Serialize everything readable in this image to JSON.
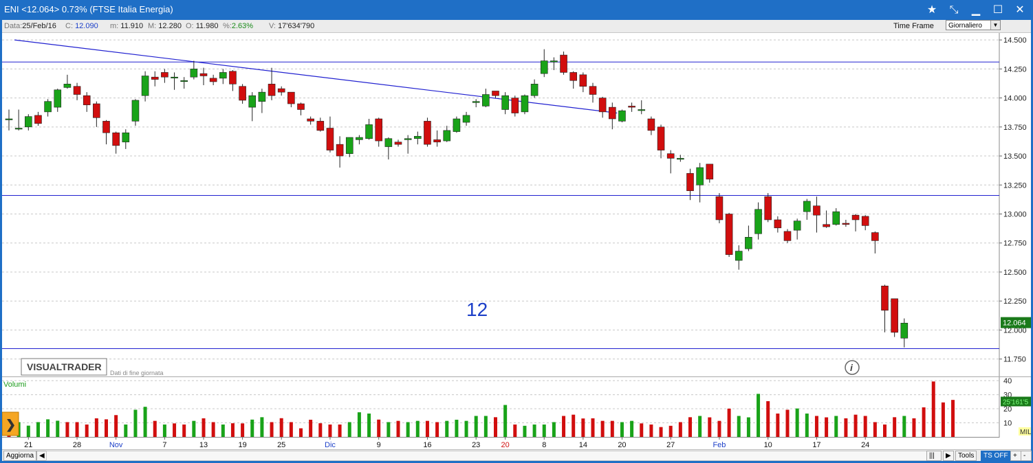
{
  "window": {
    "title": "ENI <12.064>  0.73%  (FTSE Italia Energia)"
  },
  "infobar": {
    "date_label": "Data:",
    "date_value": "25/Feb/16",
    "close_label": "C:",
    "close_value": "12.090",
    "min_label": "m:",
    "min_value": "11.910",
    "max_label": "M:",
    "max_value": "12.280",
    "open_label": "O:",
    "open_value": "11.980",
    "pct_label": "%:",
    "pct_value": "2.63%",
    "vol_label": "V:",
    "vol_value": "17'634'790",
    "timeframe_label": "Time Frame",
    "timeframe_value": "Giornaliero"
  },
  "colors": {
    "up": "#19a319",
    "down": "#d10e0e",
    "trendline": "#2020d0",
    "grid": "#c8c8c8",
    "frame": "#1f6fc6"
  },
  "chart_data": [
    {
      "type": "candlestick",
      "title": "",
      "ylim": [
        11.6,
        14.56
      ],
      "yticks": [
        "14.500",
        "14.250",
        "14.000",
        "13.750",
        "13.500",
        "13.250",
        "13.000",
        "12.750",
        "12.500",
        "12.250",
        "12.000",
        "11.750"
      ],
      "ytick_values": [
        14.5,
        14.25,
        14.0,
        13.75,
        13.5,
        13.25,
        13.0,
        12.75,
        12.5,
        12.25,
        12.0,
        11.75
      ],
      "grid": true,
      "x_ticks": [
        {
          "i": 2,
          "label": "21",
          "color": "#111"
        },
        {
          "i": 7,
          "label": "28",
          "color": "#111"
        },
        {
          "i": 11,
          "label": "Nov",
          "color": "#1c3fc8"
        },
        {
          "i": 16,
          "label": "7",
          "color": "#111"
        },
        {
          "i": 20,
          "label": "13",
          "color": "#111"
        },
        {
          "i": 24,
          "label": "19",
          "color": "#111"
        },
        {
          "i": 28,
          "label": "25",
          "color": "#111"
        },
        {
          "i": 33,
          "label": "Dic",
          "color": "#1c3fc8"
        },
        {
          "i": 38,
          "label": "9",
          "color": "#111"
        },
        {
          "i": 43,
          "label": "16",
          "color": "#111"
        },
        {
          "i": 48,
          "label": "23",
          "color": "#111"
        },
        {
          "i": 51,
          "label": "20",
          "color": "#d10e0e"
        },
        {
          "i": 55,
          "label": "8",
          "color": "#111"
        },
        {
          "i": 59,
          "label": "14",
          "color": "#111"
        },
        {
          "i": 63,
          "label": "20",
          "color": "#111"
        },
        {
          "i": 68,
          "label": "27",
          "color": "#111"
        },
        {
          "i": 73,
          "label": "Feb",
          "color": "#1c3fc8"
        },
        {
          "i": 78,
          "label": "10",
          "color": "#111"
        },
        {
          "i": 83,
          "label": "17",
          "color": "#111"
        },
        {
          "i": 88,
          "label": "24",
          "color": "#111"
        }
      ],
      "candles": [
        [
          13.82,
          13.82,
          13.9,
          13.72
        ],
        [
          13.74,
          13.74,
          13.9,
          13.72
        ],
        [
          13.75,
          13.84,
          13.86,
          13.72
        ],
        [
          13.85,
          13.78,
          13.88,
          13.76
        ],
        [
          13.88,
          13.97,
          13.99,
          13.84
        ],
        [
          13.92,
          14.07,
          14.08,
          13.88
        ],
        [
          14.09,
          14.12,
          14.2,
          14.08
        ],
        [
          14.1,
          14.03,
          14.13,
          13.98
        ],
        [
          14.02,
          13.94,
          14.05,
          13.88
        ],
        [
          13.95,
          13.83,
          13.97,
          13.75
        ],
        [
          13.8,
          13.7,
          13.81,
          13.6
        ],
        [
          13.7,
          13.59,
          13.71,
          13.52
        ],
        [
          13.62,
          13.7,
          13.73,
          13.56
        ],
        [
          13.8,
          13.98,
          13.99,
          13.76
        ],
        [
          14.02,
          14.19,
          14.23,
          13.97
        ],
        [
          14.18,
          14.16,
          14.23,
          14.1
        ],
        [
          14.22,
          14.18,
          14.25,
          14.13
        ],
        [
          14.18,
          14.18,
          14.22,
          14.07
        ],
        [
          14.15,
          14.15,
          14.18,
          14.08
        ],
        [
          14.18,
          14.25,
          14.32,
          14.16
        ],
        [
          14.21,
          14.19,
          14.26,
          14.11
        ],
        [
          14.17,
          14.14,
          14.2,
          14.11
        ],
        [
          14.17,
          14.22,
          14.25,
          14.12
        ],
        [
          14.23,
          14.12,
          14.24,
          14.06
        ],
        [
          14.1,
          13.98,
          14.12,
          13.95
        ],
        [
          13.92,
          14.02,
          14.05,
          13.8
        ],
        [
          13.97,
          14.05,
          14.08,
          13.87
        ],
        [
          14.12,
          14.02,
          14.26,
          13.98
        ],
        [
          14.08,
          14.05,
          14.1,
          14.02
        ],
        [
          14.05,
          13.95,
          14.05,
          13.92
        ],
        [
          13.95,
          13.9,
          13.96,
          13.85
        ],
        [
          13.82,
          13.8,
          13.84,
          13.77
        ],
        [
          13.8,
          13.72,
          13.83,
          13.71
        ],
        [
          13.74,
          13.55,
          13.84,
          13.53
        ],
        [
          13.6,
          13.5,
          13.67,
          13.4
        ],
        [
          13.52,
          13.66,
          13.66,
          13.49
        ],
        [
          13.64,
          13.66,
          13.68,
          13.6
        ],
        [
          13.65,
          13.77,
          13.82,
          13.64
        ],
        [
          13.82,
          13.63,
          13.83,
          13.58
        ],
        [
          13.58,
          13.65,
          13.66,
          13.47
        ],
        [
          13.62,
          13.6,
          13.64,
          13.58
        ],
        [
          13.64,
          13.65,
          13.68,
          13.52
        ],
        [
          13.65,
          13.67,
          13.71,
          13.6
        ],
        [
          13.8,
          13.6,
          13.83,
          13.58
        ],
        [
          13.64,
          13.62,
          13.72,
          13.58
        ],
        [
          13.63,
          13.72,
          13.76,
          13.62
        ],
        [
          13.71,
          13.82,
          13.84,
          13.7
        ],
        [
          13.79,
          13.85,
          13.88,
          13.76
        ],
        [
          13.96,
          13.97,
          13.99,
          13.92
        ],
        [
          13.93,
          14.03,
          14.08,
          13.92
        ],
        [
          14.06,
          14.02,
          14.06,
          14.0
        ],
        [
          13.9,
          14.02,
          14.05,
          13.86
        ],
        [
          14.0,
          13.87,
          14.02,
          13.84
        ],
        [
          13.88,
          14.02,
          14.03,
          13.86
        ],
        [
          14.02,
          14.12,
          14.16,
          14.0
        ],
        [
          14.21,
          14.32,
          14.42,
          14.18
        ],
        [
          14.31,
          14.32,
          14.35,
          14.24
        ],
        [
          14.37,
          14.22,
          14.4,
          14.2
        ],
        [
          14.22,
          14.15,
          14.23,
          14.08
        ],
        [
          14.2,
          14.1,
          14.22,
          14.05
        ],
        [
          14.1,
          14.03,
          14.13,
          13.96
        ],
        [
          14.0,
          13.88,
          14.01,
          13.83
        ],
        [
          13.92,
          13.82,
          13.96,
          13.73
        ],
        [
          13.8,
          13.89,
          13.9,
          13.79
        ],
        [
          13.93,
          13.92,
          13.96,
          13.88
        ],
        [
          13.9,
          13.9,
          13.98,
          13.86
        ],
        [
          13.82,
          13.72,
          13.84,
          13.68
        ],
        [
          13.75,
          13.55,
          13.77,
          13.48
        ],
        [
          13.52,
          13.48,
          13.55,
          13.35
        ],
        [
          13.48,
          13.48,
          13.51,
          13.45
        ],
        [
          13.35,
          13.2,
          13.39,
          13.12
        ],
        [
          13.25,
          13.4,
          13.44,
          13.1
        ],
        [
          13.43,
          13.3,
          13.43,
          13.27
        ],
        [
          13.15,
          12.95,
          13.18,
          12.92
        ],
        [
          13.0,
          12.65,
          13.01,
          12.63
        ],
        [
          12.6,
          12.68,
          12.73,
          12.52
        ],
        [
          12.7,
          12.8,
          12.9,
          12.68
        ],
        [
          12.83,
          13.04,
          13.1,
          12.78
        ],
        [
          13.15,
          12.95,
          13.18,
          12.93
        ],
        [
          12.95,
          12.88,
          12.98,
          12.84
        ],
        [
          12.85,
          12.77,
          12.87,
          12.75
        ],
        [
          12.86,
          12.94,
          12.96,
          12.78
        ],
        [
          13.02,
          13.11,
          13.13,
          12.95
        ],
        [
          13.07,
          12.99,
          13.15,
          12.84
        ],
        [
          12.91,
          12.89,
          13.03,
          12.88
        ],
        [
          12.91,
          13.02,
          13.05,
          12.9
        ],
        [
          12.92,
          12.91,
          12.95,
          12.89
        ],
        [
          12.99,
          12.95,
          13.0,
          12.85
        ],
        [
          12.98,
          12.9,
          12.99,
          12.86
        ],
        [
          12.84,
          12.77,
          12.85,
          12.66
        ],
        [
          12.38,
          12.17,
          12.39,
          11.98
        ],
        [
          12.27,
          11.98,
          12.27,
          11.94
        ],
        [
          11.93,
          12.06,
          12.1,
          11.85
        ]
      ],
      "trendline": {
        "x1": 0,
        "y1": 14.5,
        "x2": 62.5,
        "y2": 13.87
      },
      "hlines": [
        14.31,
        13.16,
        11.84
      ],
      "annotation": "12",
      "price_marker": "12.064",
      "logo_text": "VISUALTRADER",
      "logo_note": "Dati di fine giornata",
      "info_icon": "info-icon"
    },
    {
      "type": "bar",
      "title": "Volumi",
      "ylim": [
        0,
        42
      ],
      "yticks": [
        "40",
        "30",
        "20",
        "10"
      ],
      "ytick_values": [
        40,
        30,
        20,
        10
      ],
      "unit_label": "MIL",
      "last_value_label": "25'161'5",
      "values": [
        17,
        10.5,
        8,
        10.5,
        12.5,
        11.5,
        10.5,
        10.5,
        8.8,
        13.2,
        12.5,
        15.5,
        8.8,
        19.3,
        21.4,
        11.4,
        8.8,
        9.6,
        8.8,
        11.4,
        13.2,
        10.5,
        8.8,
        9.7,
        9.6,
        12.3,
        14.0,
        10.5,
        13.3,
        10.5,
        6.1,
        12.2,
        9.7,
        8.8,
        8.8,
        10.5,
        17.5,
        16.6,
        12.3,
        10.5,
        11.4,
        10.5,
        11.4,
        11.4,
        10.5,
        11.4,
        12.2,
        11.4,
        14.9,
        14.9,
        14.0,
        22.7,
        8.8,
        7.9,
        8.8,
        8.8,
        10.5,
        14.9,
        15.8,
        13.1,
        13.2,
        11.4,
        11.4,
        10.5,
        11.4,
        9.6,
        8.8,
        7.0,
        7.9,
        10.5,
        14.0,
        14.9,
        13.9,
        11.4,
        20.1,
        14.9,
        13.9,
        30.6,
        25.4,
        16.6,
        19.3,
        20.2,
        16.6,
        14.9,
        13.9,
        14.9,
        13.2,
        15.8,
        14.9,
        10.5,
        8.8,
        14.0,
        14.9,
        13.2,
        21.0,
        39.4,
        24.5,
        26.3
      ],
      "colors_up": [
        false,
        true,
        true,
        true,
        true,
        true,
        false,
        false,
        false,
        false,
        false,
        false,
        true,
        true,
        true,
        false,
        true,
        false,
        false,
        true,
        false,
        false,
        true,
        false,
        false,
        true,
        true,
        false,
        false,
        false,
        false,
        false,
        false,
        false,
        false,
        true,
        true,
        true,
        false,
        true,
        false,
        true,
        true,
        false,
        false,
        true,
        true,
        true,
        true,
        true,
        false,
        true,
        false,
        true,
        true,
        true,
        true,
        false,
        false,
        false,
        false,
        false,
        false,
        true,
        true,
        false,
        false,
        false,
        false,
        false,
        false,
        true,
        false,
        false,
        false,
        true,
        true,
        true,
        false,
        false,
        false,
        true,
        true,
        false,
        false,
        true,
        false,
        false,
        false,
        false,
        false,
        false,
        true
      ]
    }
  ],
  "bottombar": {
    "update_label": "Aggiorna",
    "tools_label": "Tools",
    "ts_label": "TS OFF",
    "plus_label": "+",
    "minus_label": "-"
  }
}
